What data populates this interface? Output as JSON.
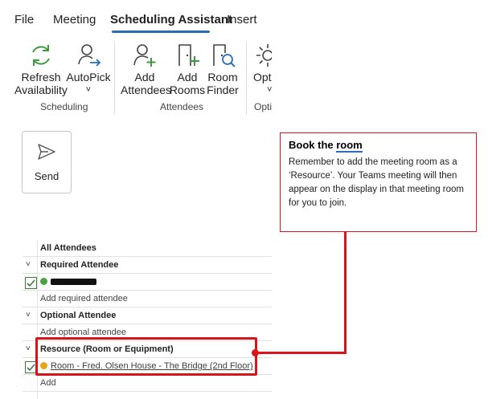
{
  "tabs": [
    {
      "label": "File"
    },
    {
      "label": "Meeting"
    },
    {
      "label": "Scheduling Assistant"
    },
    {
      "label": "Insert"
    }
  ],
  "ribbon": {
    "scheduling_group": {
      "label": "Scheduling",
      "refresh_line1": "Refresh",
      "refresh_line2": "Availability",
      "autopick_line1": "AutoPick",
      "autopick_icon": "chevron-down"
    },
    "attendees_group": {
      "label": "Attendees",
      "add_attendees_line1": "Add",
      "add_attendees_line2": "Attendees",
      "add_rooms_line1": "Add",
      "add_rooms_line2": "Rooms",
      "room_finder_line1": "Room",
      "room_finder_line2": "Finder"
    },
    "options_group": {
      "label": "Opti",
      "options_line1": "Opti",
      "options_chevron": "˅"
    }
  },
  "send": {
    "label": "Send"
  },
  "callout": {
    "title_prefix": "Book the ",
    "title_emphasis": "room",
    "body": "Remember to add the meeting room as a ‘Resource’. Your Teams meeting will then appear on the display in that meeting room for you to join."
  },
  "attendees": {
    "header": "All Attendees",
    "required_section": "Required Attendee",
    "required_placeholder": "Add required attendee",
    "optional_section": "Optional Attendee",
    "optional_placeholder": "Add optional attendee",
    "resource_section": "Resource (Room or Equipment)",
    "room_name": "Room - Fred. Olsen House - The Bridge (2nd Floor)",
    "resource_placeholder": "Add"
  },
  "colors": {
    "accent_blue": "#2b6cb8",
    "icon_green": "#3c9b3c",
    "callout_red": "#d8141d",
    "status_available": "#4aa33f",
    "status_tentative": "#e5a519"
  }
}
